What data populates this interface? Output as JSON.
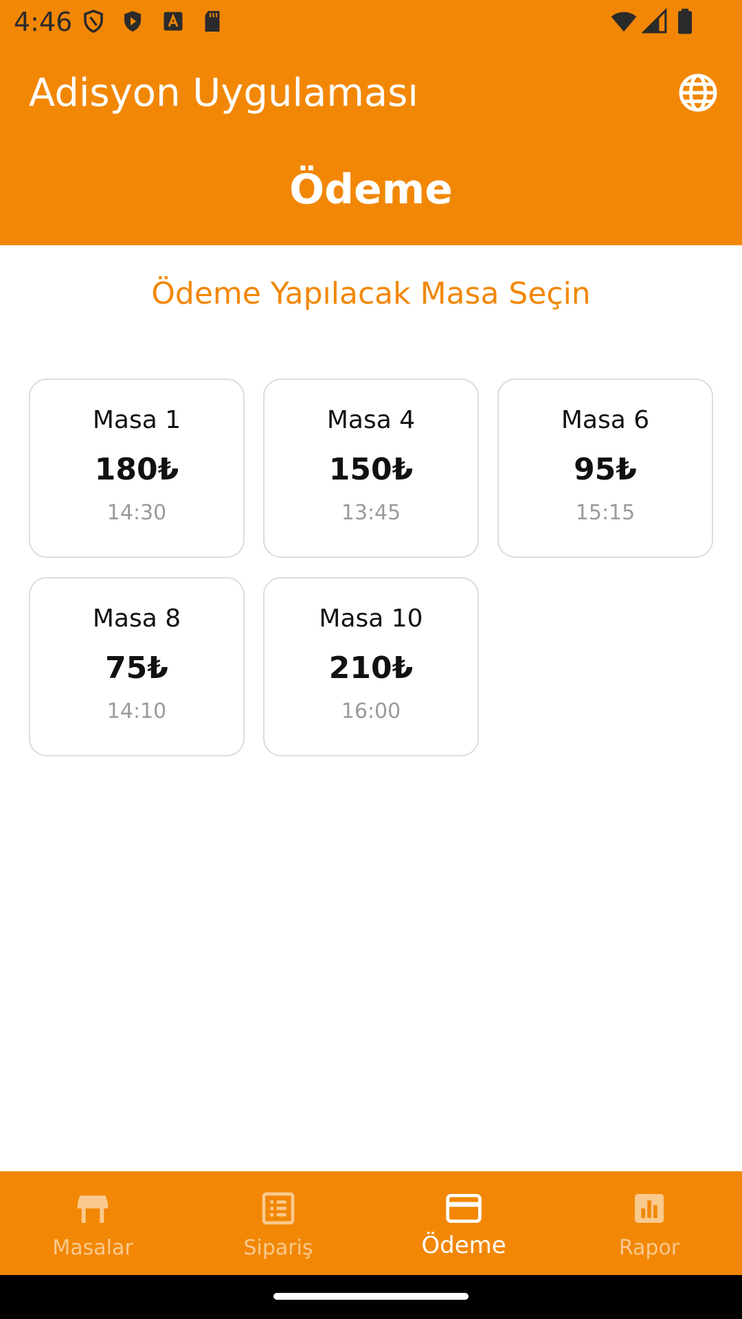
{
  "status_bar": {
    "time": "4:46",
    "icons": [
      "shield-icon",
      "play-protect-icon",
      "font-a-icon",
      "sd-card-icon",
      "wifi-icon",
      "signal-icon",
      "battery-icon"
    ]
  },
  "app_bar": {
    "title": "Adisyon Uygulaması",
    "action_icon": "globe-icon",
    "page_heading": "Ödeme",
    "color": "#F28705"
  },
  "main": {
    "section_title": "Ödeme Yapılacak Masa Seçin",
    "tables": [
      {
        "name": "Masa 1",
        "amount": "180₺",
        "time": "14:30"
      },
      {
        "name": "Masa 4",
        "amount": "150₺",
        "time": "13:45"
      },
      {
        "name": "Masa 6",
        "amount": "95₺",
        "time": "15:15"
      },
      {
        "name": "Masa 8",
        "amount": "75₺",
        "time": "14:10"
      },
      {
        "name": "Masa 10",
        "amount": "210₺",
        "time": "16:00"
      }
    ]
  },
  "bottom_nav": {
    "items": [
      {
        "label": "Masalar",
        "icon": "table-icon",
        "active": false
      },
      {
        "label": "Sipariş",
        "icon": "list-icon",
        "active": false
      },
      {
        "label": "Ödeme",
        "icon": "credit-card-icon",
        "active": true
      },
      {
        "label": "Rapor",
        "icon": "bar-chart-icon",
        "active": false
      }
    ]
  }
}
